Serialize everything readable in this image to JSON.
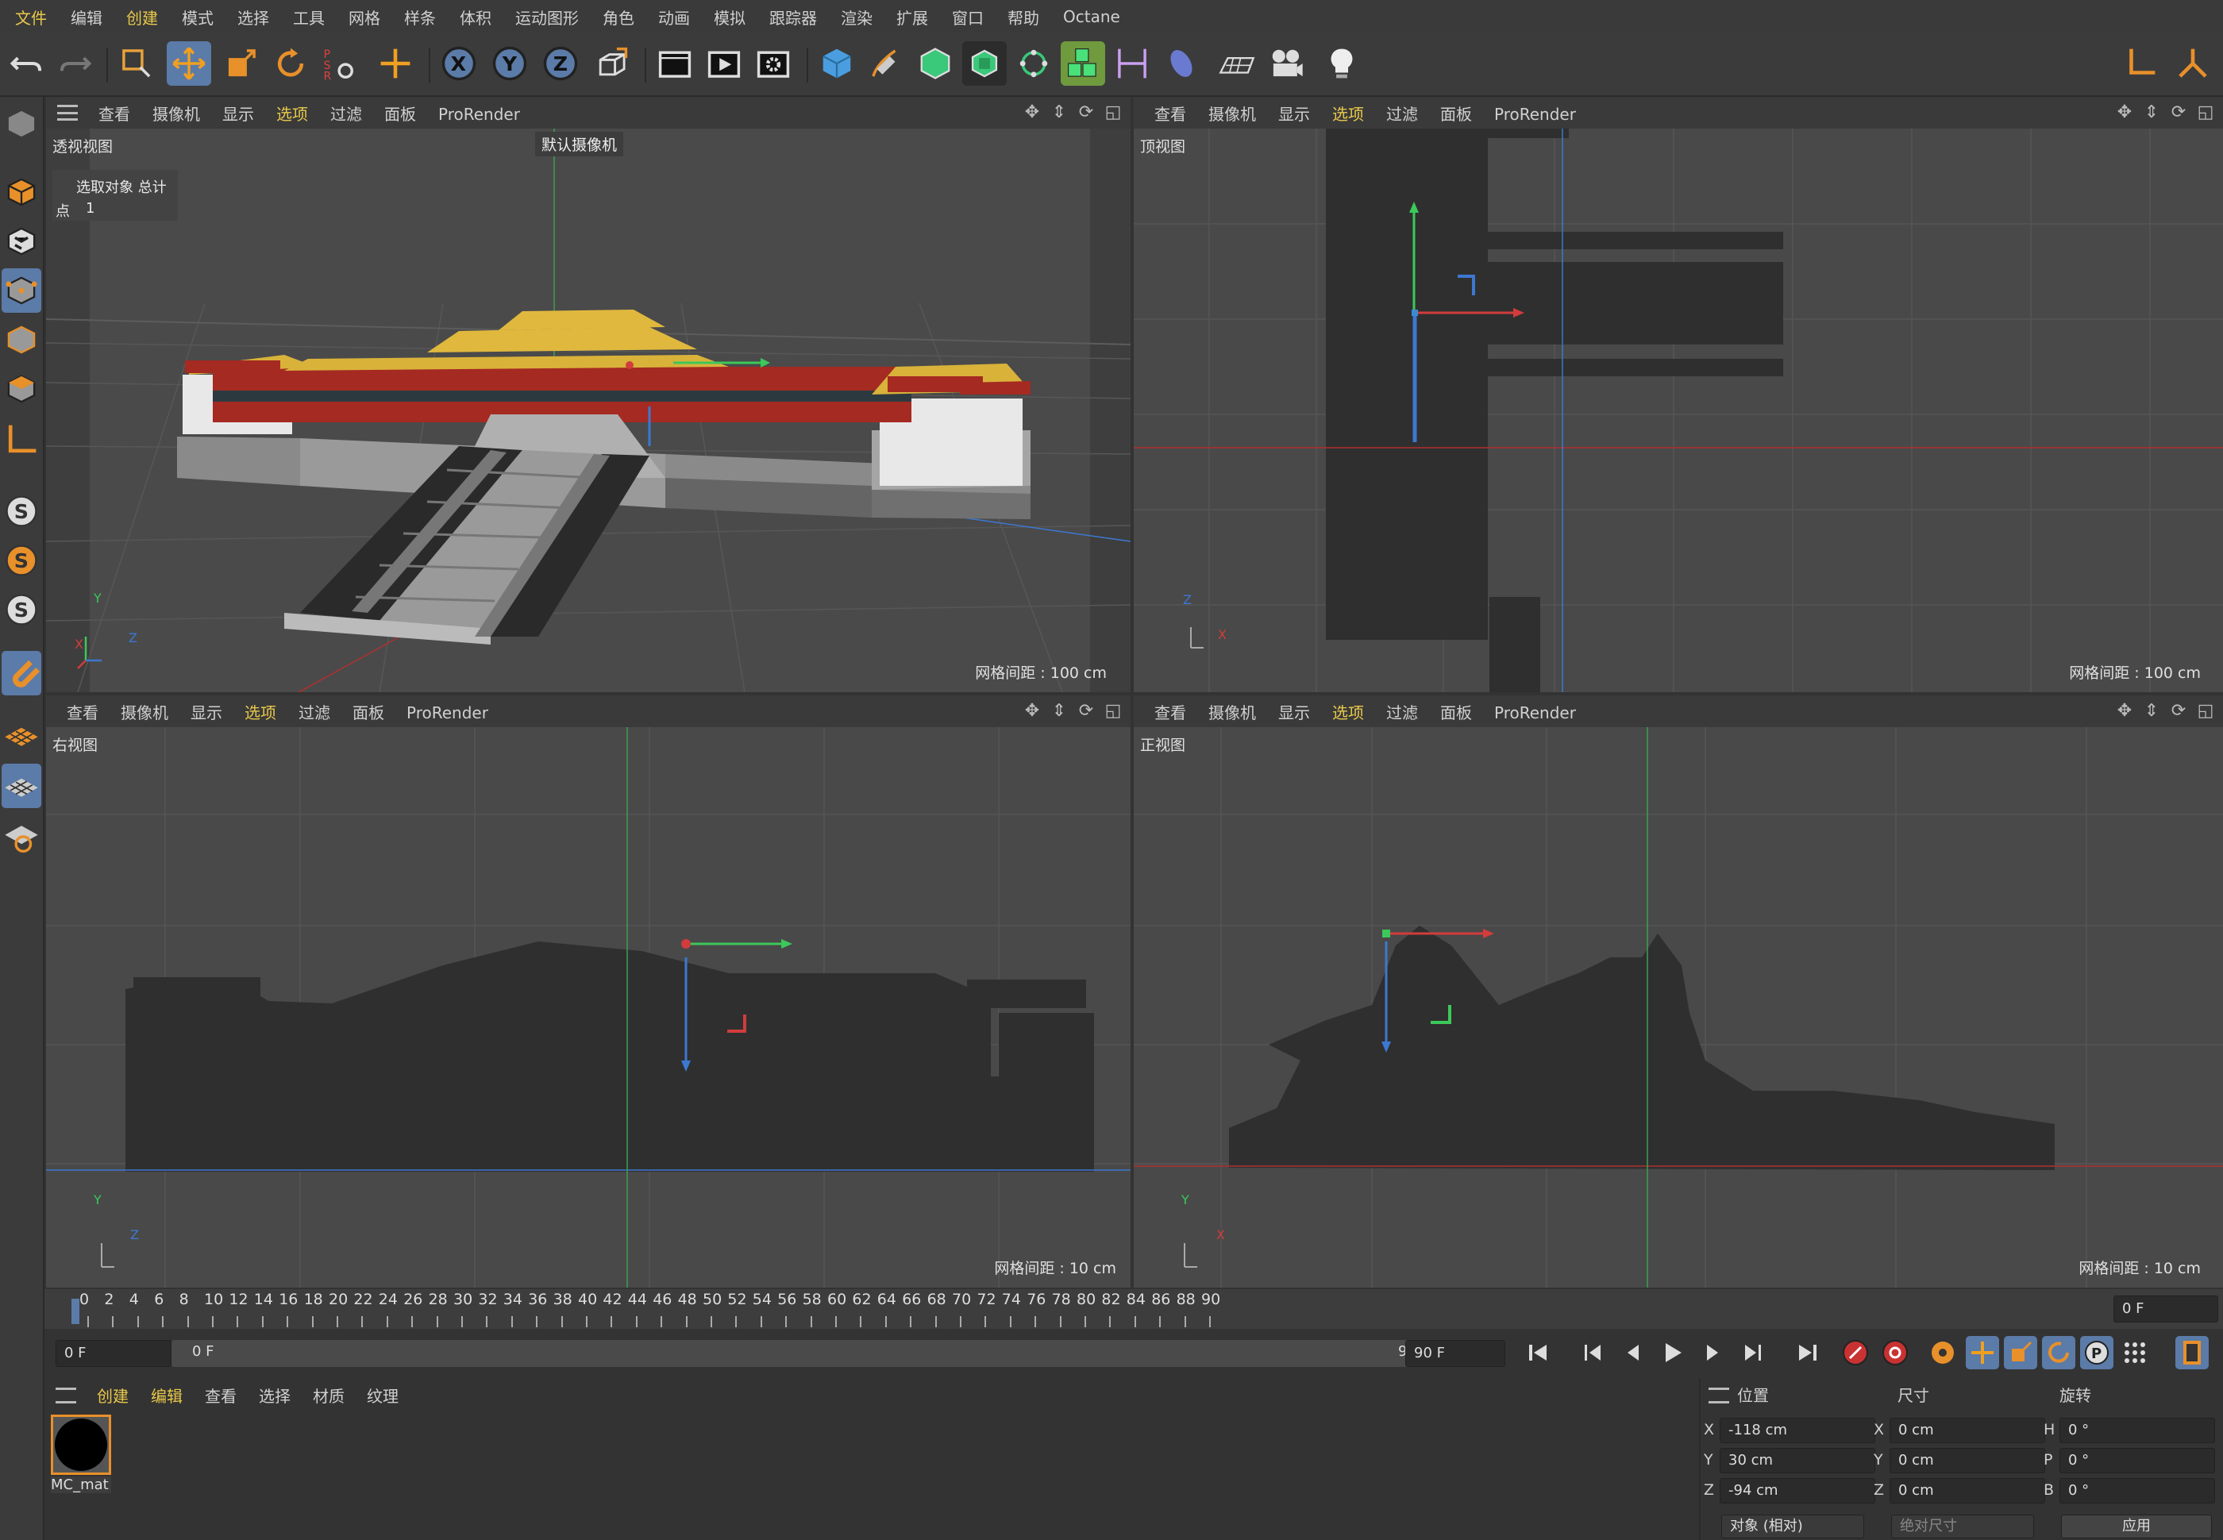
{
  "menubar": {
    "items": [
      "文件",
      "编辑",
      "创建",
      "模式",
      "选择",
      "工具",
      "网格",
      "样条",
      "体积",
      "运动图形",
      "角色",
      "动画",
      "模拟",
      "跟踪器",
      "渲染",
      "扩展",
      "窗口",
      "帮助",
      "Octane"
    ]
  },
  "viewport_menu": [
    "查看",
    "摄像机",
    "显示",
    "选项",
    "过滤",
    "面板",
    "ProRender"
  ],
  "viewports": {
    "perspective": {
      "name": "透视视图",
      "camera": "默认摄像机",
      "grid": "网格间距 : 100 cm",
      "stats_header": "选取对象 总计",
      "stats_label": "点",
      "stats_value": "1"
    },
    "top": {
      "name": "顶视图",
      "grid": "网格间距 : 100 cm"
    },
    "right": {
      "name": "右视图",
      "grid": "网格间距 : 10 cm"
    },
    "front": {
      "name": "正视图",
      "grid": "网格间距 : 10 cm"
    }
  },
  "axis_labels": {
    "x": "X",
    "y": "Y",
    "z": "Z"
  },
  "timeline": {
    "ticks": [
      "0",
      "2",
      "4",
      "6",
      "8",
      "10",
      "12",
      "14",
      "16",
      "18",
      "20",
      "22",
      "24",
      "26",
      "28",
      "30",
      "32",
      "34",
      "36",
      "38",
      "40",
      "42",
      "44",
      "46",
      "48",
      "50",
      "52",
      "54",
      "56",
      "58",
      "60",
      "62",
      "64",
      "66",
      "68",
      "70",
      "72",
      "74",
      "76",
      "78",
      "80",
      "82",
      "84",
      "86",
      "88",
      "90"
    ],
    "current_frame": "0 F",
    "start": "0 F",
    "range_start": "0 F",
    "range_end": "90 F",
    "end": "90 F"
  },
  "material_panel": {
    "menu": [
      "创建",
      "编辑",
      "查看",
      "选择",
      "材质",
      "纹理"
    ],
    "material_name": "MC_mat"
  },
  "attributes": {
    "headers": [
      "位置",
      "尺寸",
      "旋转"
    ],
    "rows": [
      {
        "axis": "X",
        "pos": "-118 cm",
        "size_axis": "X",
        "size": "0 cm",
        "rot_axis": "H",
        "rot": "0 °"
      },
      {
        "axis": "Y",
        "pos": "30 cm",
        "size_axis": "Y",
        "size": "0 cm",
        "rot_axis": "P",
        "rot": "0 °"
      },
      {
        "axis": "Z",
        "pos": "-94 cm",
        "size_axis": "Z",
        "size": "0 cm",
        "rot_axis": "B",
        "rot": "0 °"
      }
    ],
    "mode": "对象 (相对)",
    "size_mode": "绝对尺寸",
    "apply": "应用"
  },
  "colors": {
    "accent": "#e8c84a",
    "selected": "#5b7ba8",
    "x_axis": "#d23c3c",
    "y_axis": "#3cc85a",
    "z_axis": "#3c78d2",
    "roof": "#d9b23a",
    "wall": "#a52a22"
  },
  "icons": {
    "toolbar": [
      "undo-icon",
      "redo-icon",
      "live-select-icon",
      "move-icon",
      "scale-icon",
      "rotate-icon",
      "psr-icon",
      "transform-icon",
      "x-axis-lock-icon",
      "y-axis-lock-icon",
      "z-axis-lock-icon",
      "world-coord-icon",
      "render-region-icon",
      "render-view-icon",
      "render-settings-icon",
      "cube-icon",
      "pen-icon",
      "subdivision-icon",
      "cloner-icon",
      "mograph-icon",
      "voxel-icon",
      "bend-icon",
      "deformer-icon",
      "floor-icon",
      "camera-icon",
      "light-icon"
    ]
  }
}
